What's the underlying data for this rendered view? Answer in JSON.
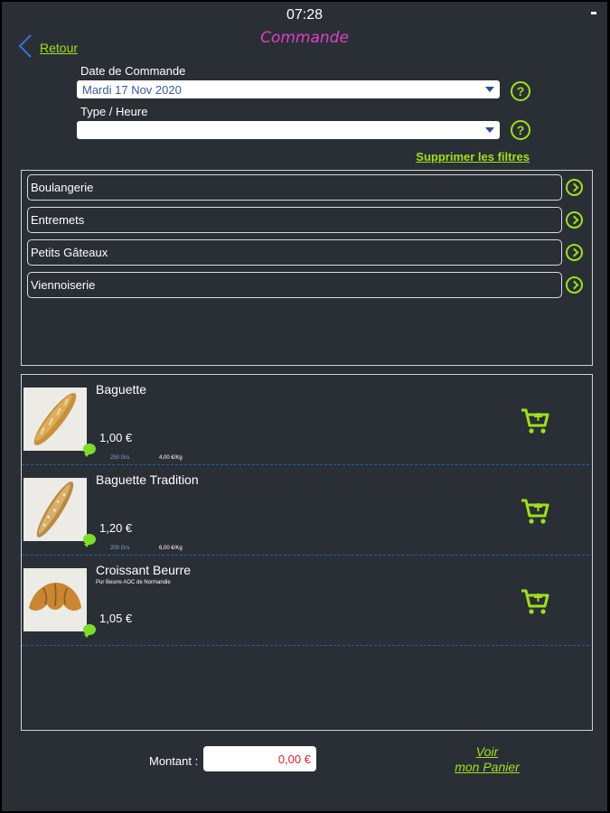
{
  "status_bar": {
    "time": "07:28"
  },
  "header": {
    "back_label": "Retour",
    "title": "Commande"
  },
  "filters": {
    "date_label": "Date de Commande",
    "date_value": "Mardi 17 Nov 2020",
    "type_label": "Type / Heure",
    "type_value": "",
    "help_symbol": "?",
    "clear_label": "Supprimer les filtres"
  },
  "categories": [
    {
      "label": "Boulangerie"
    },
    {
      "label": "Entremets"
    },
    {
      "label": "Petits Gâteaux"
    },
    {
      "label": "Viennoiserie"
    }
  ],
  "products": [
    {
      "name": "Baguette",
      "description": "",
      "price": "1,00 €",
      "weight": "250 Grs",
      "price_per_kg": "4,00 €/Kg"
    },
    {
      "name": "Baguette Tradition",
      "description": "",
      "price": "1,20 €",
      "weight": "200 Grs",
      "price_per_kg": "6,00 €/Kg"
    },
    {
      "name": "Croissant Beurre",
      "description": "Pur Beurre AOC de Normandie",
      "price": "1,05 €",
      "weight": "",
      "price_per_kg": ""
    }
  ],
  "footer": {
    "amount_label": "Montant :",
    "amount_value": "0,00 €",
    "cart_link_line1": "Voir",
    "cart_link_line2": "mon Panier"
  },
  "colors": {
    "background": "#2a2f36",
    "accent_green": "#9fe01f",
    "title_pink": "#e03fc6",
    "amount_red": "#e0242c"
  }
}
